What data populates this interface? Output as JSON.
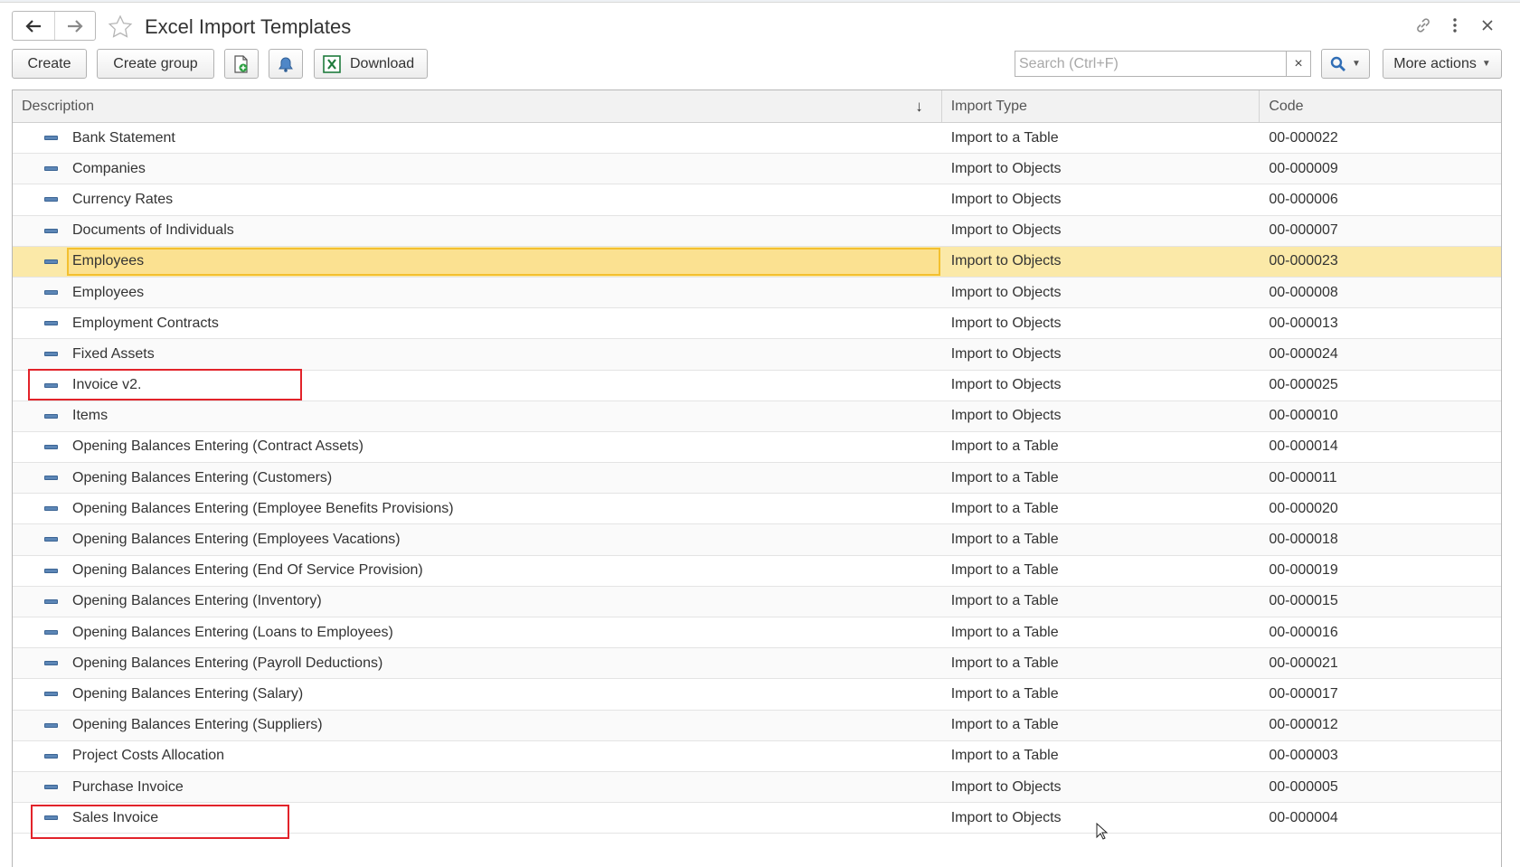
{
  "window": {
    "title": "Excel Import Templates"
  },
  "toolbar": {
    "create_label": "Create",
    "create_group_label": "Create group",
    "download_label": "Download",
    "search_placeholder": "Search (Ctrl+F)",
    "search_clear": "×",
    "more_actions_label": "More actions"
  },
  "table": {
    "columns": [
      "Description",
      "Import Type",
      "Code"
    ],
    "sort_indicator": "↓",
    "selected_index": 4,
    "rows": [
      {
        "description": "Bank Statement",
        "import_type": "Import to a Table",
        "code": "00-000022"
      },
      {
        "description": "Companies",
        "import_type": "Import to Objects",
        "code": "00-000009"
      },
      {
        "description": "Currency Rates",
        "import_type": "Import to Objects",
        "code": "00-000006"
      },
      {
        "description": "Documents of Individuals",
        "import_type": "Import to Objects",
        "code": "00-000007"
      },
      {
        "description": "Employees",
        "import_type": "Import to Objects",
        "code": "00-000023"
      },
      {
        "description": "Employees",
        "import_type": "Import to Objects",
        "code": "00-000008"
      },
      {
        "description": "Employment Contracts",
        "import_type": "Import to Objects",
        "code": "00-000013"
      },
      {
        "description": "Fixed Assets",
        "import_type": "Import to Objects",
        "code": "00-000024"
      },
      {
        "description": "Invoice v2.",
        "import_type": "Import to Objects",
        "code": "00-000025"
      },
      {
        "description": "Items",
        "import_type": "Import to Objects",
        "code": "00-000010"
      },
      {
        "description": "Opening Balances Entering (Contract Assets)",
        "import_type": "Import to a Table",
        "code": "00-000014"
      },
      {
        "description": "Opening Balances Entering (Customers)",
        "import_type": "Import to a Table",
        "code": "00-000011"
      },
      {
        "description": "Opening Balances Entering (Employee Benefits Provisions)",
        "import_type": "Import to a Table",
        "code": "00-000020"
      },
      {
        "description": "Opening Balances Entering (Employees Vacations)",
        "import_type": "Import to a Table",
        "code": "00-000018"
      },
      {
        "description": "Opening Balances Entering (End Of Service Provision)",
        "import_type": "Import to a Table",
        "code": "00-000019"
      },
      {
        "description": "Opening Balances Entering (Inventory)",
        "import_type": "Import to a Table",
        "code": "00-000015"
      },
      {
        "description": "Opening Balances Entering (Loans to Employees)",
        "import_type": "Import to a Table",
        "code": "00-000016"
      },
      {
        "description": "Opening Balances Entering (Payroll Deductions)",
        "import_type": "Import to a Table",
        "code": "00-000021"
      },
      {
        "description": "Opening Balances Entering (Salary)",
        "import_type": "Import to a Table",
        "code": "00-000017"
      },
      {
        "description": "Opening Balances Entering (Suppliers)",
        "import_type": "Import to a Table",
        "code": "00-000012"
      },
      {
        "description": "Project Costs Allocation",
        "import_type": "Import to a Table",
        "code": "00-000003"
      },
      {
        "description": "Purchase Invoice",
        "import_type": "Import to Objects",
        "code": "00-000005"
      },
      {
        "description": "Sales Invoice",
        "import_type": "Import to Objects",
        "code": "00-000004"
      }
    ]
  },
  "colors": {
    "selection_fill": "#fbe191",
    "selection_border": "#f3c02f",
    "annotation_red": "#e2232a",
    "excel_green": "#1e7b3c",
    "accent_blue": "#2f6db5"
  },
  "icons": {
    "back": "arrow-left-icon",
    "forward": "arrow-right-icon",
    "favorite": "star-icon",
    "link": "link-icon",
    "menu": "kebab-menu-icon",
    "close": "close-icon",
    "add_document": "add-document-icon",
    "notify": "bell-icon",
    "excel": "excel-icon",
    "search": "magnifier-icon",
    "row": "catalog-item-icon"
  }
}
